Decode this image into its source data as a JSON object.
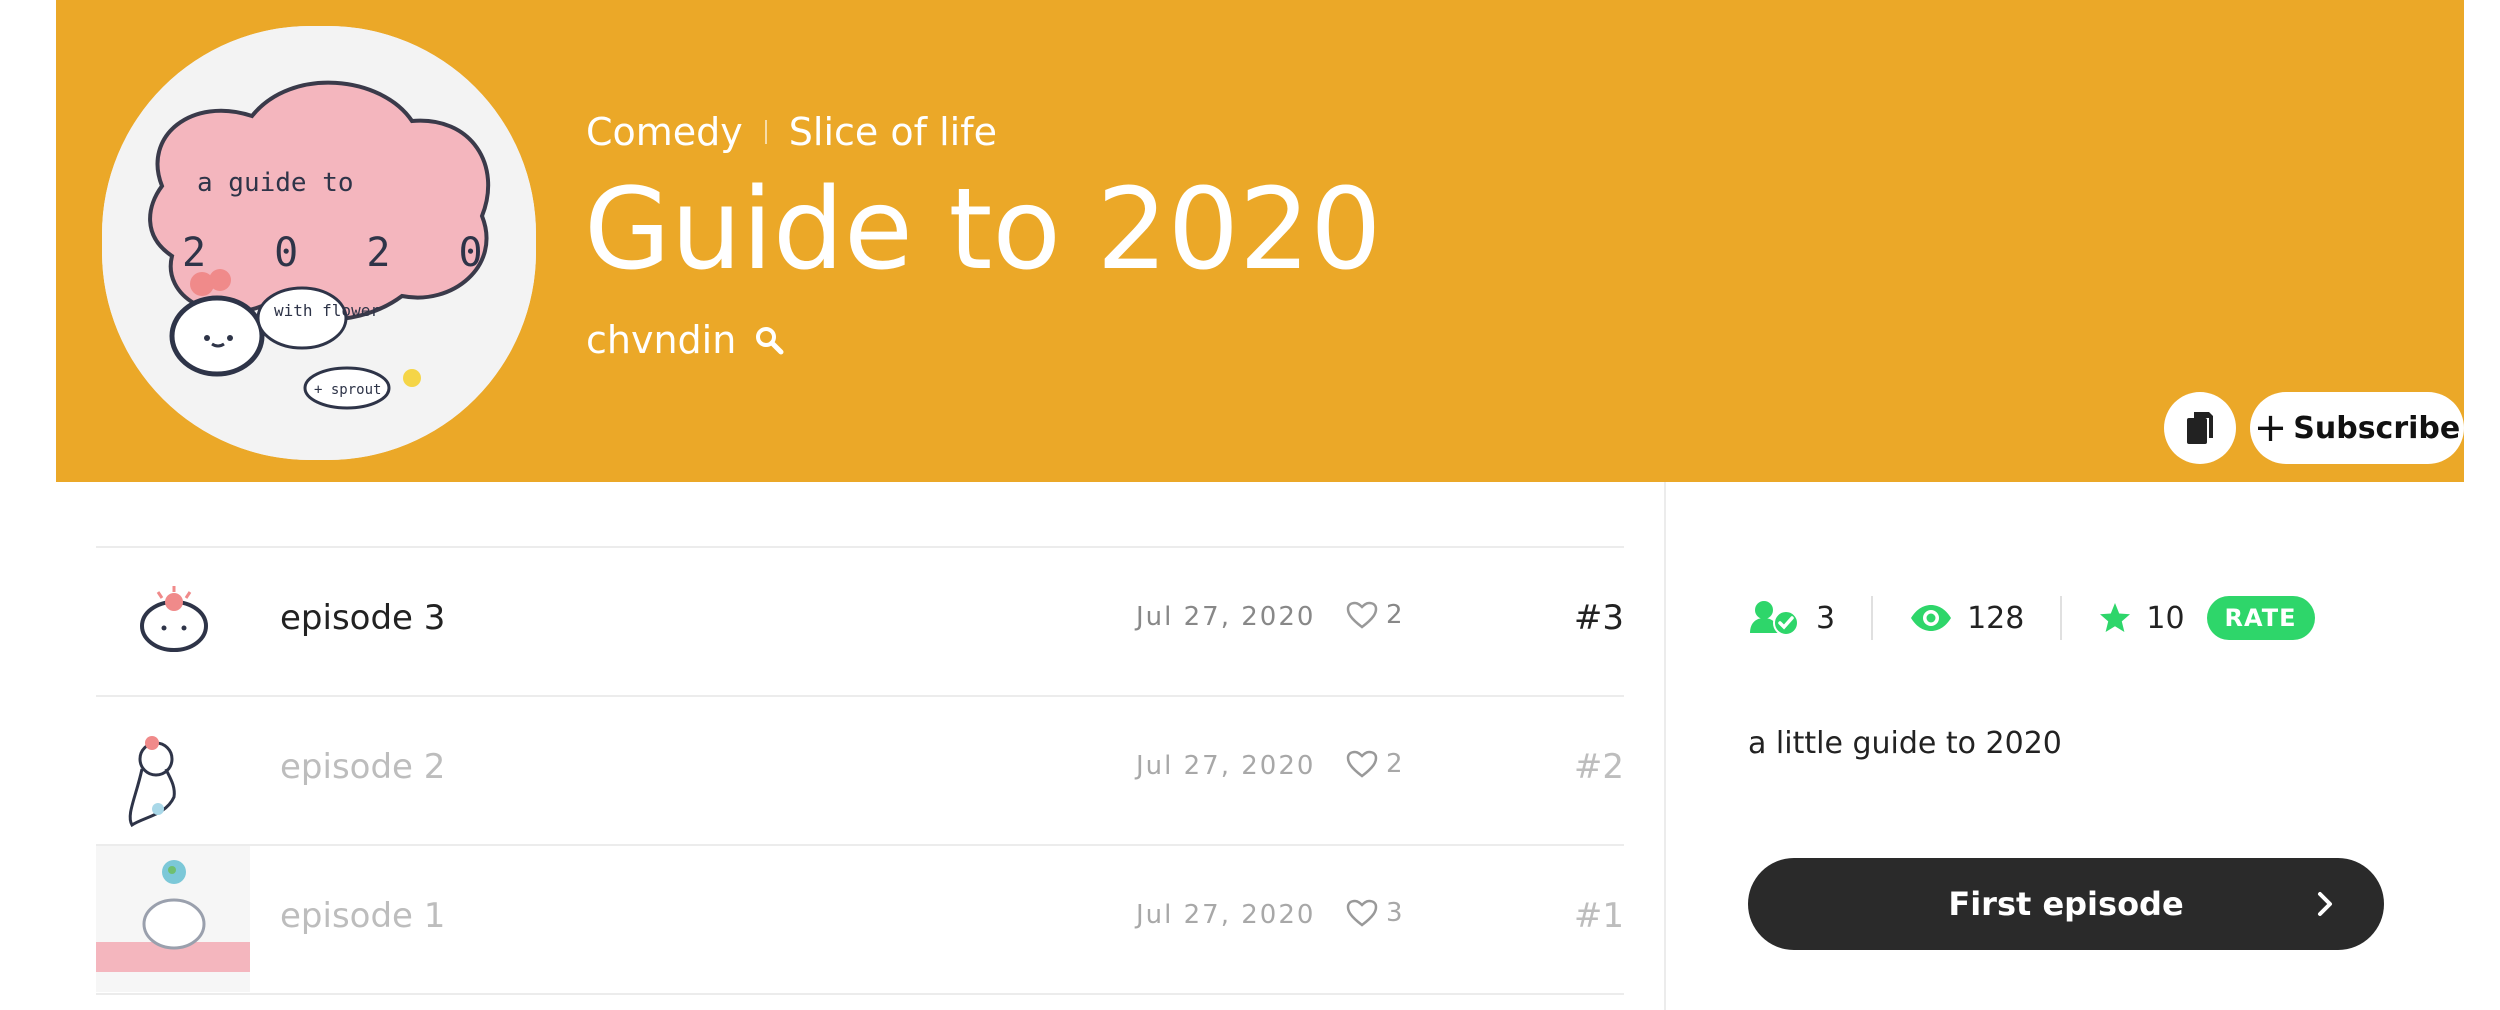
{
  "series": {
    "genres": [
      "Comedy",
      "Slice of life"
    ],
    "title": "Guide to 2020",
    "author": "chvndin",
    "cover_text": [
      "a guide to",
      "2 0 2 0",
      "with flower",
      "+ sprout"
    ],
    "actions": {
      "subscribe_label": "Subscribe",
      "copy_icon": "copy-icon"
    }
  },
  "episodes": [
    {
      "name": "episode 3",
      "date": "Jul 27, 2020",
      "likes": "2",
      "number": "#3",
      "read": false
    },
    {
      "name": "episode 2",
      "date": "Jul 27, 2020",
      "likes": "2",
      "number": "#2",
      "read": true
    },
    {
      "name": "episode 1",
      "date": "Jul 27, 2020",
      "likes": "3",
      "number": "#1",
      "read": true
    }
  ],
  "sidebar": {
    "subscribers": "3",
    "views": "128",
    "rating": "10",
    "rate_label": "RATE",
    "description": "a little guide to 2020",
    "first_episode_label": "First episode"
  },
  "colors": {
    "banner": "#EBA828",
    "accent_green": "#2ED66A",
    "button_dark": "#2a2a2a"
  }
}
